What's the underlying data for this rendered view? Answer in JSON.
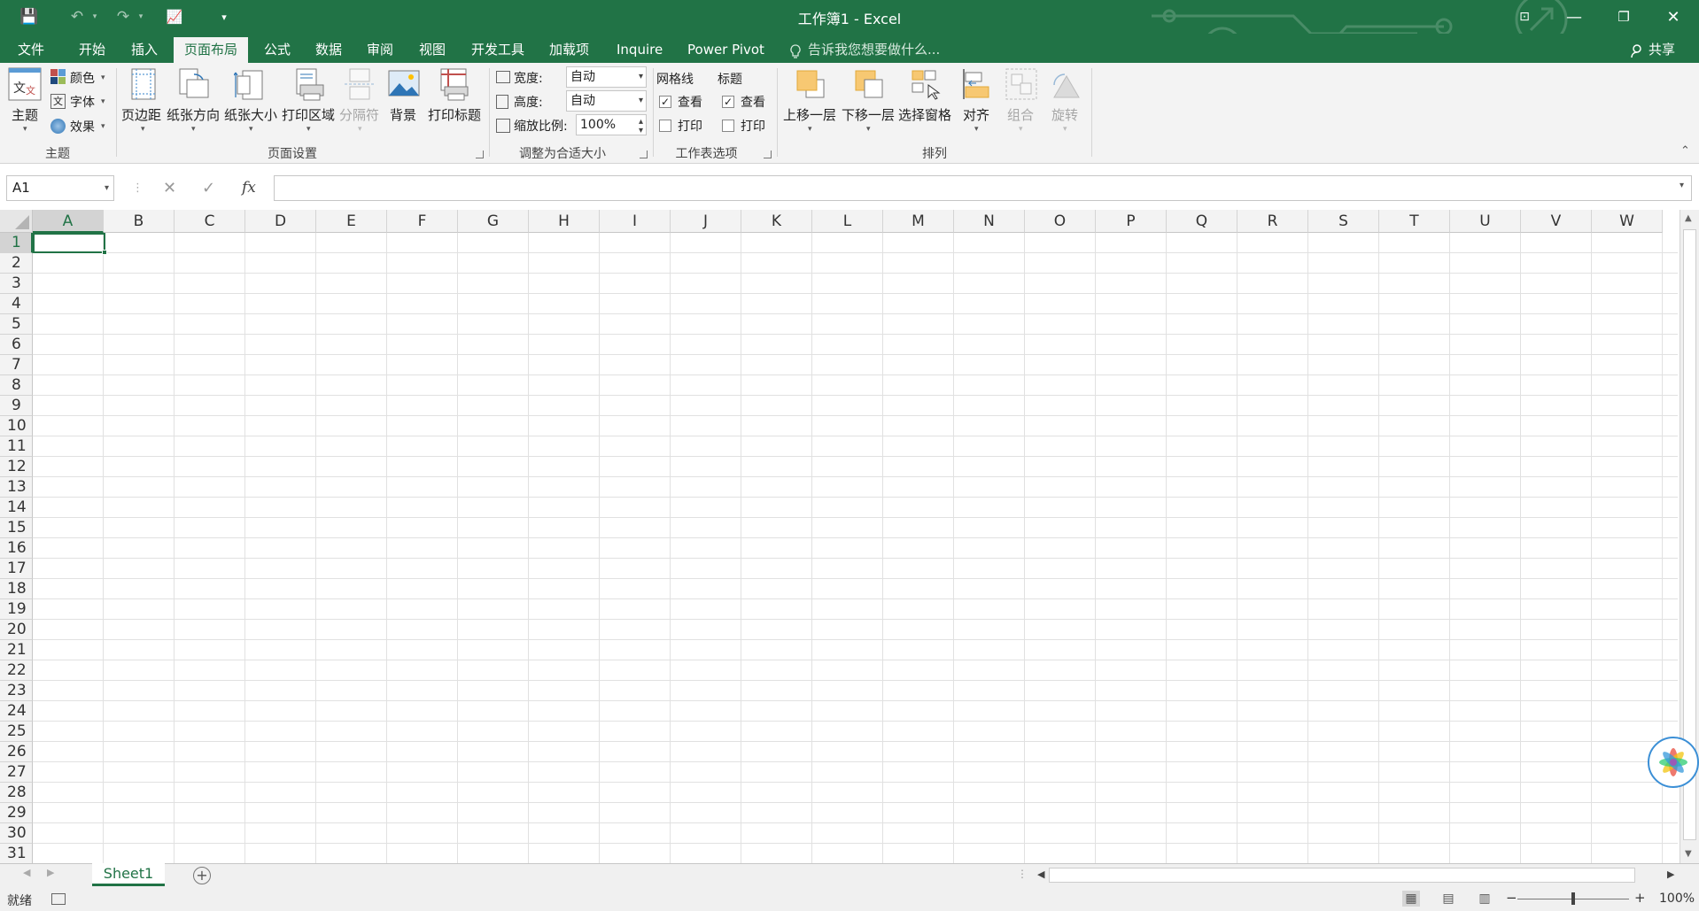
{
  "titlebar": {
    "title": "工作簿1 - Excel",
    "save_icon": "💾",
    "undo_icon": "↶",
    "redo_icon": "↷",
    "chart_icon": "📈",
    "customize_icon": "▾",
    "ribbon_options_icon": "⊡",
    "minimize_icon": "—",
    "restore_icon": "❐",
    "close_icon": "✕"
  },
  "tabs": [
    {
      "label": "文件"
    },
    {
      "label": "开始"
    },
    {
      "label": "插入"
    },
    {
      "label": "页面布局"
    },
    {
      "label": "公式"
    },
    {
      "label": "数据"
    },
    {
      "label": "审阅"
    },
    {
      "label": "视图"
    },
    {
      "label": "开发工具"
    },
    {
      "label": "加载项"
    },
    {
      "label": "Inquire"
    },
    {
      "label": "Power Pivot"
    }
  ],
  "active_tab": "页面布局",
  "tell_me": "告诉我您想要做什么...",
  "share": "共享",
  "ribbon": {
    "theme": {
      "themes_label": "主题",
      "colors_label": "颜色",
      "fonts_label": "字体",
      "effects_label": "效果",
      "group_label": "主题"
    },
    "page_setup": {
      "margins_label": "页边距",
      "orientation_label": "纸张方向",
      "size_label": "纸张大小",
      "print_area_label": "打印区域",
      "breaks_label": "分隔符",
      "background_label": "背景",
      "print_titles_label": "打印标题",
      "group_label": "页面设置"
    },
    "scale_to_fit": {
      "width_label": "宽度:",
      "width_value": "自动",
      "height_label": "高度:",
      "height_value": "自动",
      "scale_label": "缩放比例:",
      "scale_value": "100%",
      "group_label": "调整为合适大小"
    },
    "sheet_options": {
      "gridlines_label": "网格线",
      "headings_label": "标题",
      "view_label": "查看",
      "print_label": "打印",
      "gridlines_view": true,
      "gridlines_print": false,
      "headings_view": true,
      "headings_print": false,
      "group_label": "工作表选项"
    },
    "arrange": {
      "bring_forward_label": "上移一层",
      "send_backward_label": "下移一层",
      "selection_pane_label": "选择窗格",
      "align_label": "对齐",
      "group_obj_label": "组合",
      "rotate_label": "旋转",
      "group_label": "排列"
    }
  },
  "formula_bar": {
    "name_box": "A1",
    "cancel_icon": "✕",
    "enter_icon": "✓",
    "fx_label": "fx",
    "value": ""
  },
  "grid": {
    "columns": [
      "A",
      "B",
      "C",
      "D",
      "E",
      "F",
      "G",
      "H",
      "I",
      "J",
      "K",
      "L",
      "M",
      "N",
      "O",
      "P",
      "Q",
      "R",
      "S",
      "T",
      "U",
      "V",
      "W"
    ],
    "rows": [
      "1",
      "2",
      "3",
      "4",
      "5",
      "6",
      "7",
      "8",
      "9",
      "10",
      "11",
      "12",
      "13",
      "14",
      "15",
      "16",
      "17",
      "18",
      "19",
      "20",
      "21",
      "22",
      "23",
      "24",
      "25",
      "26",
      "27",
      "28",
      "29",
      "30",
      "31"
    ],
    "selected_cell": "A1"
  },
  "sheets": [
    {
      "label": "Sheet1"
    }
  ],
  "add_sheet_icon": "+",
  "status": {
    "ready": "就绪",
    "zoom": "100%",
    "zoom_out": "−",
    "zoom_in": "+"
  },
  "colors": {
    "accent": "#217346",
    "ribbon_bg": "#f3f3f3",
    "grid_line": "#e1e1e1"
  }
}
